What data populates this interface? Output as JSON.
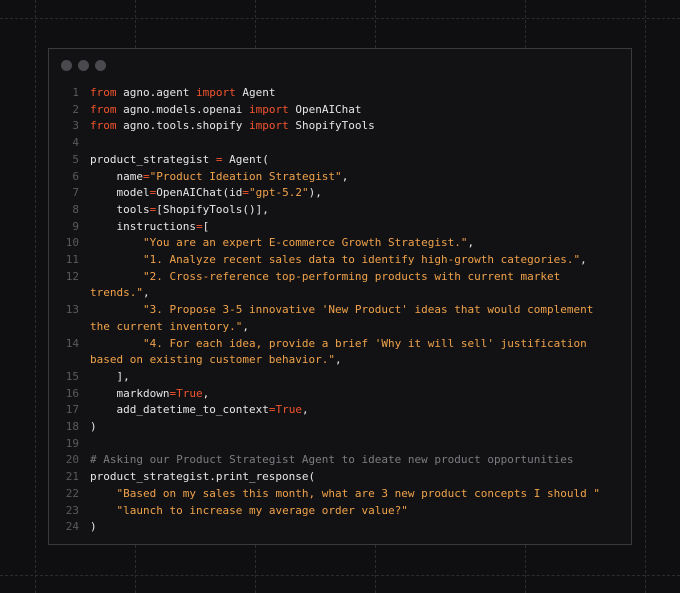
{
  "window": {
    "dots": [
      "close",
      "minimize",
      "maximize"
    ],
    "colors": {
      "keyword": "#f2542d",
      "string": "#f0a24a",
      "comment": "#7c7c80",
      "text": "#e6e6e6",
      "line_number": "#5a5a5e"
    }
  },
  "code": {
    "lines": [
      {
        "num": "1",
        "tokens": [
          {
            "t": "kw",
            "v": "from"
          },
          {
            "t": "p",
            "v": " agno.agent "
          },
          {
            "t": "kw",
            "v": "import"
          },
          {
            "t": "p",
            "v": " Agent"
          }
        ]
      },
      {
        "num": "2",
        "tokens": [
          {
            "t": "kw",
            "v": "from"
          },
          {
            "t": "p",
            "v": " agno.models.openai "
          },
          {
            "t": "kw",
            "v": "import"
          },
          {
            "t": "p",
            "v": " OpenAIChat"
          }
        ]
      },
      {
        "num": "3",
        "tokens": [
          {
            "t": "kw",
            "v": "from"
          },
          {
            "t": "p",
            "v": " agno.tools.shopify "
          },
          {
            "t": "kw",
            "v": "import"
          },
          {
            "t": "p",
            "v": " ShopifyTools"
          }
        ]
      },
      {
        "num": "4",
        "tokens": []
      },
      {
        "num": "5",
        "tokens": [
          {
            "t": "p",
            "v": "product_strategist "
          },
          {
            "t": "kw",
            "v": "="
          },
          {
            "t": "p",
            "v": " Agent("
          }
        ]
      },
      {
        "num": "6",
        "tokens": [
          {
            "t": "p",
            "v": "    name"
          },
          {
            "t": "kw",
            "v": "="
          },
          {
            "t": "str",
            "v": "\"Product Ideation Strategist\""
          },
          {
            "t": "p",
            "v": ","
          }
        ]
      },
      {
        "num": "7",
        "tokens": [
          {
            "t": "p",
            "v": "    model"
          },
          {
            "t": "kw",
            "v": "="
          },
          {
            "t": "p",
            "v": "OpenAIChat(id"
          },
          {
            "t": "kw",
            "v": "="
          },
          {
            "t": "str",
            "v": "\"gpt-5.2\""
          },
          {
            "t": "p",
            "v": "),"
          }
        ]
      },
      {
        "num": "8",
        "tokens": [
          {
            "t": "p",
            "v": "    tools"
          },
          {
            "t": "kw",
            "v": "="
          },
          {
            "t": "p",
            "v": "[ShopifyTools()],"
          }
        ]
      },
      {
        "num": "9",
        "tokens": [
          {
            "t": "p",
            "v": "    instructions"
          },
          {
            "t": "kw",
            "v": "="
          },
          {
            "t": "p",
            "v": "["
          }
        ]
      },
      {
        "num": "10",
        "tokens": [
          {
            "t": "p",
            "v": "        "
          },
          {
            "t": "str",
            "v": "\"You are an expert E-commerce Growth Strategist.\""
          },
          {
            "t": "p",
            "v": ","
          }
        ]
      },
      {
        "num": "11",
        "tokens": [
          {
            "t": "p",
            "v": "        "
          },
          {
            "t": "str",
            "v": "\"1. Analyze recent sales data to identify high-growth categories.\""
          },
          {
            "t": "p",
            "v": ","
          }
        ]
      },
      {
        "num": "12",
        "tokens": [
          {
            "t": "p",
            "v": "        "
          },
          {
            "t": "str",
            "v": "\"2. Cross-reference top-performing products with current market trends.\""
          },
          {
            "t": "p",
            "v": ","
          }
        ]
      },
      {
        "num": "13",
        "tokens": [
          {
            "t": "p",
            "v": "        "
          },
          {
            "t": "str",
            "v": "\"3. Propose 3-5 innovative 'New Product' ideas that would complement the current inventory.\""
          },
          {
            "t": "p",
            "v": ","
          }
        ]
      },
      {
        "num": "14",
        "tokens": [
          {
            "t": "p",
            "v": "        "
          },
          {
            "t": "str",
            "v": "\"4. For each idea, provide a brief 'Why it will sell' justification based on existing customer behavior.\""
          },
          {
            "t": "p",
            "v": ","
          }
        ]
      },
      {
        "num": "15",
        "tokens": [
          {
            "t": "p",
            "v": "    ],"
          }
        ]
      },
      {
        "num": "16",
        "tokens": [
          {
            "t": "p",
            "v": "    markdown"
          },
          {
            "t": "kw",
            "v": "="
          },
          {
            "t": "kw",
            "v": "True"
          },
          {
            "t": "p",
            "v": ","
          }
        ]
      },
      {
        "num": "17",
        "tokens": [
          {
            "t": "p",
            "v": "    add_datetime_to_context"
          },
          {
            "t": "kw",
            "v": "="
          },
          {
            "t": "kw",
            "v": "True"
          },
          {
            "t": "p",
            "v": ","
          }
        ]
      },
      {
        "num": "18",
        "tokens": [
          {
            "t": "p",
            "v": ")"
          }
        ]
      },
      {
        "num": "19",
        "tokens": []
      },
      {
        "num": "20",
        "tokens": [
          {
            "t": "cm",
            "v": "# Asking our Product Strategist Agent to ideate new product opportunities"
          }
        ]
      },
      {
        "num": "21",
        "tokens": [
          {
            "t": "p",
            "v": "product_strategist.print_response("
          }
        ]
      },
      {
        "num": "22",
        "tokens": [
          {
            "t": "p",
            "v": "    "
          },
          {
            "t": "str",
            "v": "\"Based on my sales this month, what are 3 new product concepts I should \""
          }
        ]
      },
      {
        "num": "23",
        "tokens": [
          {
            "t": "p",
            "v": "    "
          },
          {
            "t": "str",
            "v": "\"launch to increase my average order value?\""
          }
        ]
      },
      {
        "num": "24",
        "tokens": [
          {
            "t": "p",
            "v": ")"
          }
        ]
      }
    ]
  }
}
